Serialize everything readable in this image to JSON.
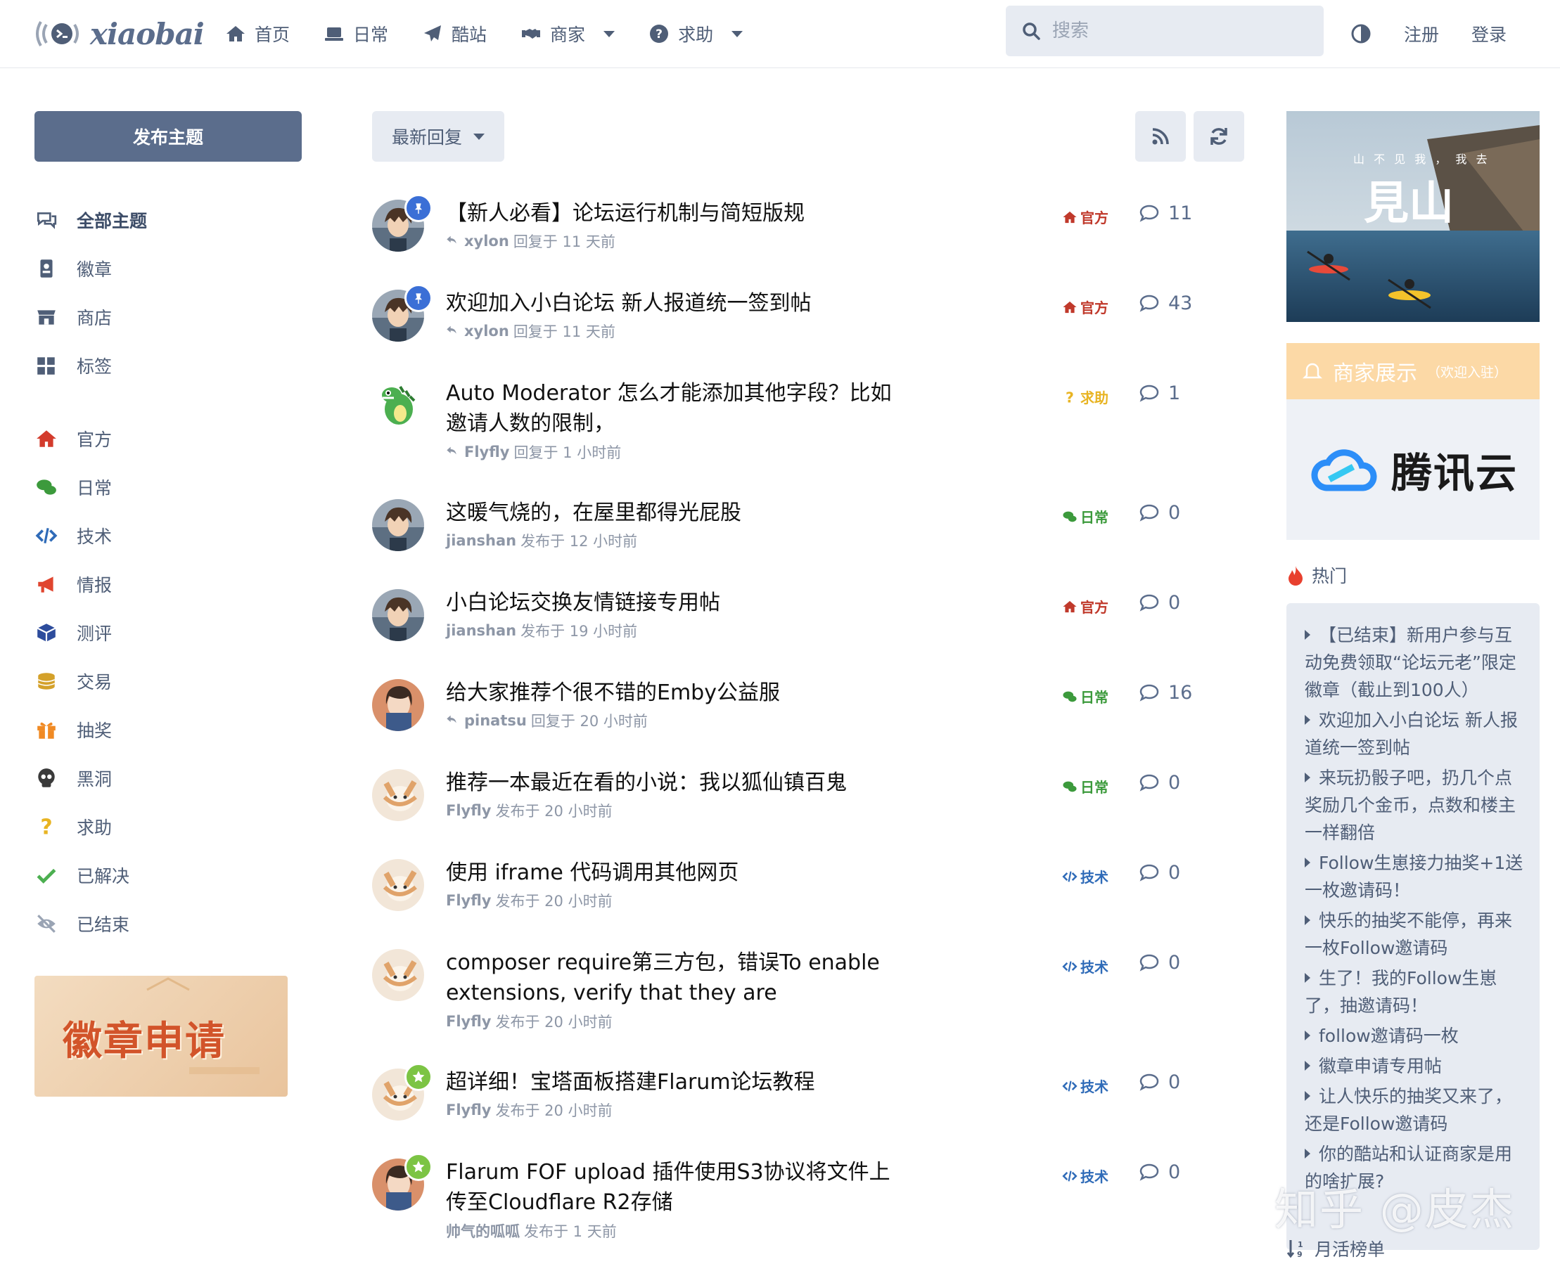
{
  "header": {
    "logo_text": "xiaobai",
    "nav": [
      {
        "label": "首页",
        "icon": "home-icon"
      },
      {
        "label": "日常",
        "icon": "laptop-icon"
      },
      {
        "label": "酷站",
        "icon": "paper-plane-icon"
      },
      {
        "label": "商家",
        "icon": "handshake-icon",
        "dropdown": true
      },
      {
        "label": "求助",
        "icon": "question-circle-icon",
        "dropdown": true
      }
    ],
    "search_placeholder": "搜索",
    "register": "注册",
    "login": "登录"
  },
  "sidebar": {
    "post_button": "发布主题",
    "items": [
      {
        "label": "全部主题",
        "icon": "comments-icon",
        "color": "#4f5e77",
        "active": true
      },
      {
        "label": "徽章",
        "icon": "id-badge-icon",
        "color": "#4f5e77"
      },
      {
        "label": "商店",
        "icon": "store-icon",
        "color": "#4f5e77"
      },
      {
        "label": "标签",
        "icon": "grid-icon",
        "color": "#4f5e77"
      },
      {
        "label": "官方",
        "icon": "home-icon",
        "color": "#d33b2c"
      },
      {
        "label": "日常",
        "icon": "chat-icon",
        "color": "#3c9a3c"
      },
      {
        "label": "技术",
        "icon": "code-icon",
        "color": "#2f6bb8"
      },
      {
        "label": "情报",
        "icon": "megaphone-icon",
        "color": "#e0452f"
      },
      {
        "label": "测评",
        "icon": "cube-icon",
        "color": "#2d4c9c"
      },
      {
        "label": "交易",
        "icon": "coins-icon",
        "color": "#d4a12a"
      },
      {
        "label": "抽奖",
        "icon": "gift-icon",
        "color": "#f08a24"
      },
      {
        "label": "黑洞",
        "icon": "skull-icon",
        "color": "#3a3a3a"
      },
      {
        "label": "求助",
        "icon": "question-icon",
        "color": "#e8b423"
      },
      {
        "label": "已解决",
        "icon": "check-icon",
        "color": "#4caf50"
      },
      {
        "label": "已结束",
        "icon": "eye-slash-icon",
        "color": "#9aa4b4"
      }
    ],
    "badge_banner_text": "徽章申请"
  },
  "toolbar": {
    "sort_label": "最新回复"
  },
  "topics": [
    {
      "title": "【新人必看】论坛运行机制与简短版规",
      "user": "xylon",
      "action": "回复于 11 天前",
      "reply": true,
      "tag": "官方",
      "tag_color": "#c0392b",
      "tag_icon": "home",
      "count": "11",
      "avatar": "boy",
      "avatar_badge": "pin"
    },
    {
      "title": "欢迎加入小白论坛 新人报道统一签到帖",
      "user": "xylon",
      "action": "回复于 11 天前",
      "reply": true,
      "tag": "官方",
      "tag_color": "#c0392b",
      "tag_icon": "home",
      "count": "43",
      "avatar": "boy",
      "avatar_badge": "pin"
    },
    {
      "title": "Auto Moderator 怎么才能添加其他字段？比如邀请人数的限制，",
      "user": "Flyfly",
      "action": "回复于 1 小时前",
      "reply": true,
      "tag": "求助",
      "tag_color": "#e8b423",
      "tag_icon": "question",
      "count": "1",
      "avatar": "dragon",
      "avatar_badge": ""
    },
    {
      "title": "这暖气烧的，在屋里都得光屁股",
      "user": "jianshan",
      "action": "发布于 12 小时前",
      "reply": false,
      "tag": "日常",
      "tag_color": "#3c9a3c",
      "tag_icon": "chat",
      "count": "0",
      "avatar": "boy",
      "avatar_badge": ""
    },
    {
      "title": "小白论坛交换友情链接专用帖",
      "user": "jianshan",
      "action": "发布于 19 小时前",
      "reply": false,
      "tag": "官方",
      "tag_color": "#c0392b",
      "tag_icon": "home",
      "count": "0",
      "avatar": "boy",
      "avatar_badge": ""
    },
    {
      "title": "给大家推荐个很不错的Emby公益服",
      "user": "pinatsu",
      "action": "回复于 20 小时前",
      "reply": true,
      "tag": "日常",
      "tag_color": "#3c9a3c",
      "tag_icon": "chat",
      "count": "16",
      "avatar": "girl",
      "avatar_badge": ""
    },
    {
      "title": "推荐一本最近在看的小说：我以狐仙镇百鬼",
      "user": "Flyfly",
      "action": "发布于 20 小时前",
      "reply": false,
      "tag": "日常",
      "tag_color": "#3c9a3c",
      "tag_icon": "chat",
      "count": "0",
      "avatar": "fox",
      "avatar_badge": ""
    },
    {
      "title": "使用 iframe 代码调用其他网页",
      "user": "Flyfly",
      "action": "发布于 20 小时前",
      "reply": false,
      "tag": "技术",
      "tag_color": "#2f6bb8",
      "tag_icon": "code",
      "count": "0",
      "avatar": "fox",
      "avatar_badge": ""
    },
    {
      "title": "composer require第三方包，错误To enable extensions, verify that they are",
      "user": "Flyfly",
      "action": "发布于 20 小时前",
      "reply": false,
      "tag": "技术",
      "tag_color": "#2f6bb8",
      "tag_icon": "code",
      "count": "0",
      "avatar": "fox",
      "avatar_badge": ""
    },
    {
      "title": "超详细！宝塔面板搭建Flarum论坛教程",
      "user": "Flyfly",
      "action": "发布于 20 小时前",
      "reply": false,
      "tag": "技术",
      "tag_color": "#2f6bb8",
      "tag_icon": "code",
      "count": "0",
      "avatar": "fox",
      "avatar_badge": "star"
    },
    {
      "title": "Flarum FOF upload 插件使用S3协议将文件上传至Cloudflare R2存储",
      "user": "帅气的呱呱",
      "action": "发布于 1 天前",
      "reply": false,
      "tag": "技术",
      "tag_color": "#2f6bb8",
      "tag_icon": "code",
      "count": "0",
      "avatar": "girl",
      "avatar_badge": "star"
    }
  ],
  "right": {
    "ad_small_text": "山 不 见 我 ， 我 去",
    "ad_big_text": "見山",
    "merchant_title": "商家展示",
    "merchant_sub": "（欢迎入驻）",
    "merchant_logo_text": "腾讯云",
    "hot_title": "热门",
    "hot_items": [
      "【已结束】新用户参与互动免费领取“论坛元老”限定徽章（截止到100人）",
      "欢迎加入小白论坛 新人报道统一签到帖",
      "来玩扔骰子吧，扔几个点奖励几个金币，点数和楼主一样翻倍",
      "Follow生崽接力抽奖+1送一枚邀请码！",
      "快乐的抽奖不能停，再来一枚Follow邀请码",
      "生了！我的Follow生崽了，抽邀请码！",
      "follow邀请码一枚",
      "徽章申请专用帖",
      "让人快乐的抽奖又来了，还是Follow邀请码",
      "你的酷站和认证商家是用的啥扩展?"
    ],
    "watermark": "知乎 @皮杰",
    "monthly_title": "月活榜单"
  },
  "colors": {
    "primary": "#5b6d8c",
    "control_bg": "#e7ebf2",
    "merchant_head": "#fcd9a6"
  }
}
